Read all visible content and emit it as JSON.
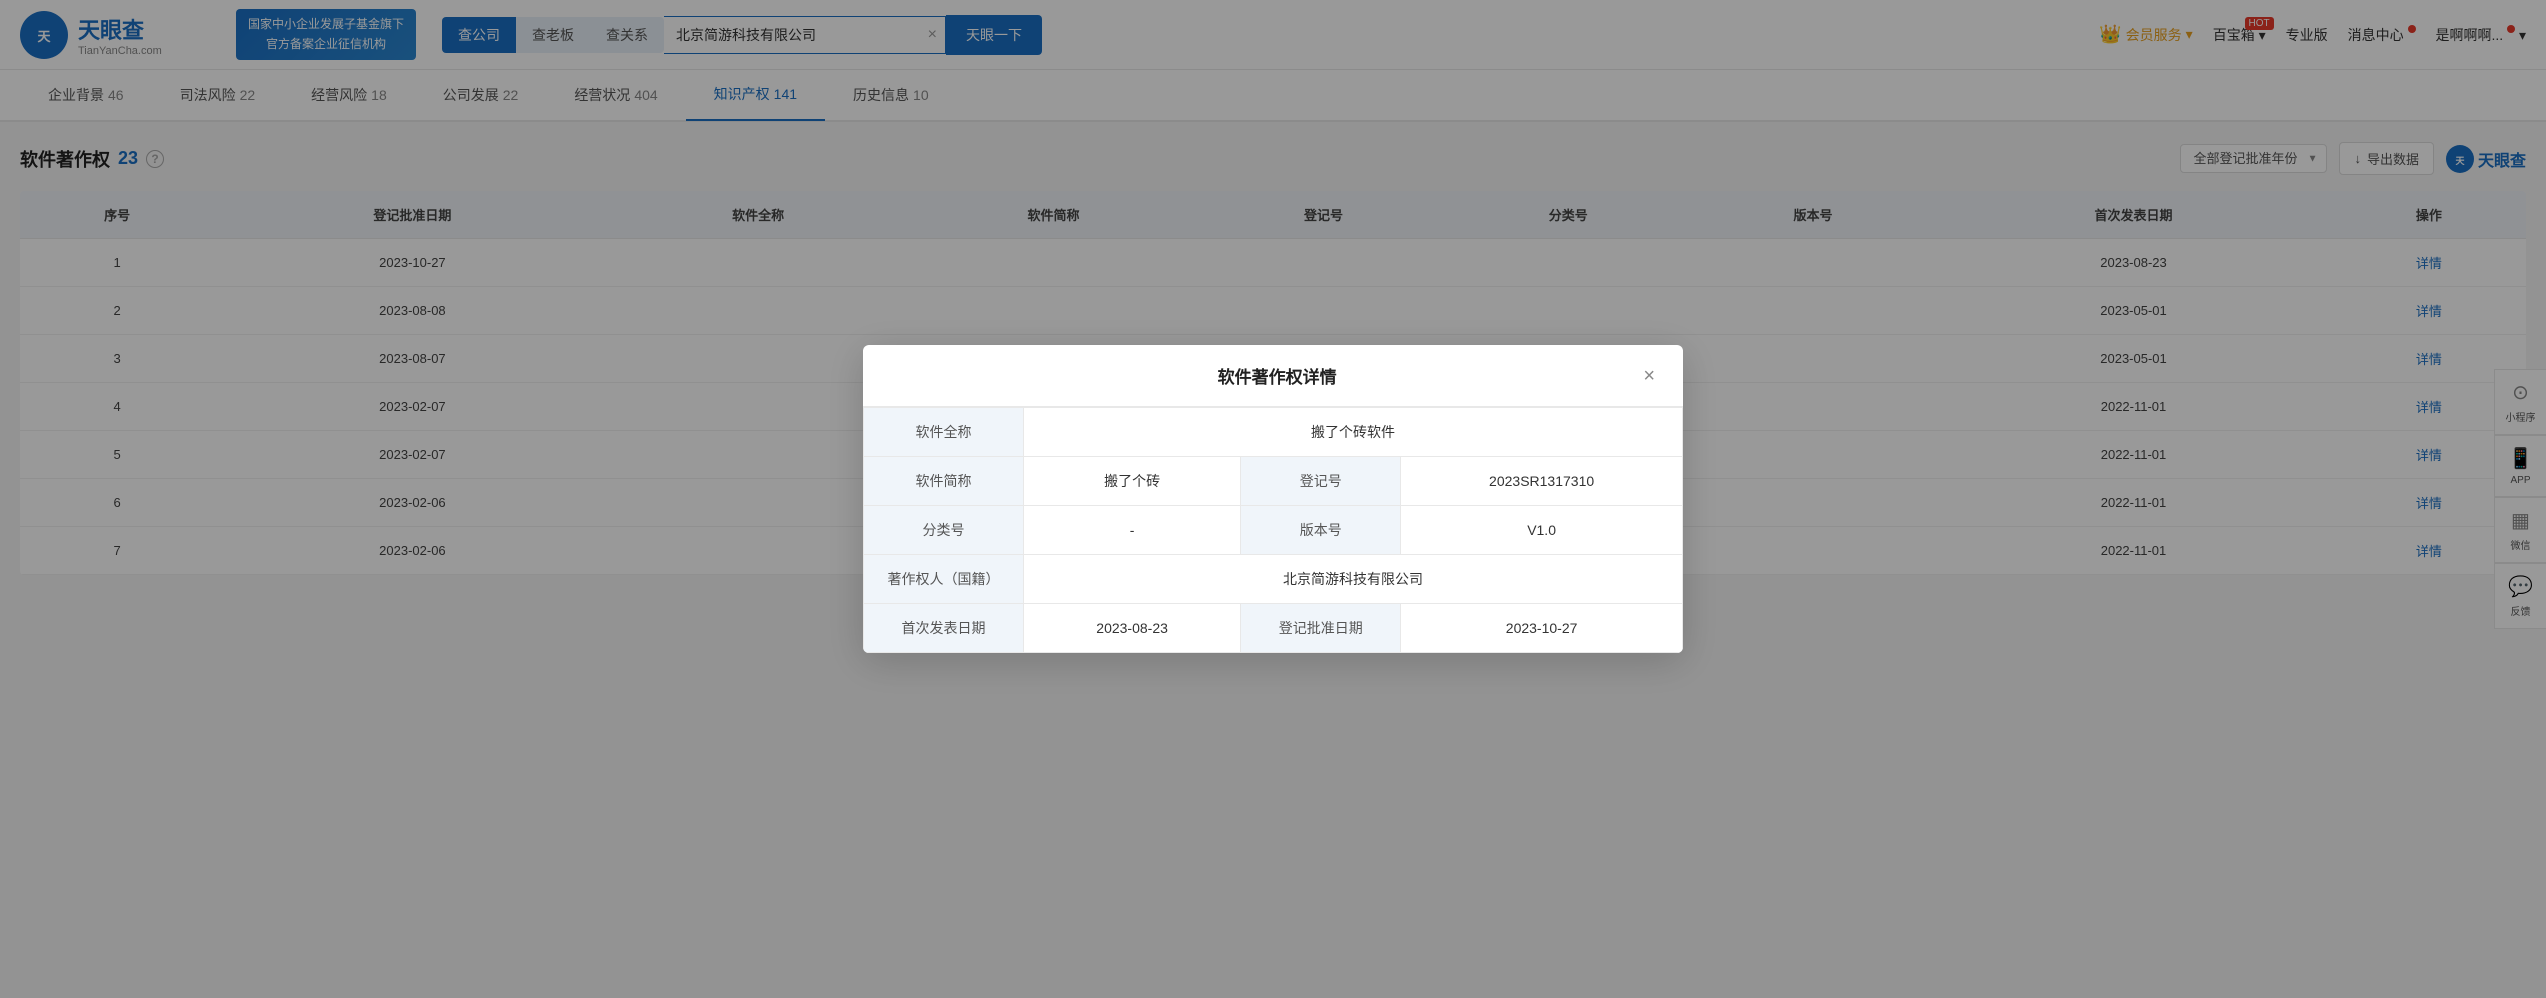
{
  "header": {
    "logo_cn": "天眼查",
    "logo_en": "TianYanCha.com",
    "banner_line1": "国家中小企业发展子基金旗下",
    "banner_line2": "官方备案企业征信机构",
    "search_tab_active": "查公司",
    "search_tab2": "查老板",
    "search_tab3": "查关系",
    "search_value": "北京简游科技有限公司",
    "search_btn": "天眼一下",
    "vip": "会员服务",
    "baobao": "百宝箱",
    "hot_label": "HOT",
    "pro": "专业版",
    "message": "消息中心",
    "user": "是啊啊啊..."
  },
  "sub_nav": {
    "items": [
      {
        "label": "企业背景",
        "count": "46",
        "active": false
      },
      {
        "label": "司法风险",
        "count": "22",
        "active": false
      },
      {
        "label": "经营风险",
        "count": "18",
        "active": false
      },
      {
        "label": "公司发展",
        "count": "22",
        "active": false
      },
      {
        "label": "经营状况",
        "count": "404",
        "active": false
      },
      {
        "label": "知识产权",
        "count": "141",
        "active": true
      },
      {
        "label": "历史信息",
        "count": "10",
        "active": false
      }
    ]
  },
  "section": {
    "title": "软件著作权",
    "count": "23",
    "year_placeholder": "全部登记批准年份",
    "export_btn": "导出数据",
    "watermark": "天眼查"
  },
  "table": {
    "columns": [
      "序号",
      "登记批准日期",
      "软件全称",
      "软件简称",
      "登记号",
      "分类号",
      "版本号",
      "首次发表日期",
      "操作"
    ],
    "rows": [
      {
        "id": 1,
        "reg_date": "2023-10-27",
        "full_name": "",
        "short_name": "",
        "reg_no": "",
        "class_no": "",
        "version": "",
        "pub_date": "2023-08-23",
        "action": "详情"
      },
      {
        "id": 2,
        "reg_date": "2023-08-08",
        "full_name": "",
        "short_name": "",
        "reg_no": "",
        "class_no": "",
        "version": "",
        "pub_date": "2023-05-01",
        "action": "详情"
      },
      {
        "id": 3,
        "reg_date": "2023-08-07",
        "full_name": "",
        "short_name": "",
        "reg_no": "",
        "class_no": "",
        "version": "",
        "pub_date": "2023-05-01",
        "action": "详情"
      },
      {
        "id": 4,
        "reg_date": "2023-02-07",
        "full_name": "",
        "short_name": "",
        "reg_no": "",
        "class_no": "",
        "version": "",
        "pub_date": "2022-11-01",
        "action": "详情"
      },
      {
        "id": 5,
        "reg_date": "2023-02-07",
        "full_name": "",
        "short_name": "",
        "reg_no": "",
        "class_no": "",
        "version": "",
        "pub_date": "2022-11-01",
        "action": "详情"
      },
      {
        "id": 6,
        "reg_date": "2023-02-06",
        "full_name": "",
        "short_name": "",
        "reg_no": "",
        "class_no": "",
        "version": "",
        "pub_date": "2022-11-01",
        "action": "详情"
      },
      {
        "id": 7,
        "reg_date": "2023-02-06",
        "full_name": "",
        "short_name": "",
        "reg_no": "",
        "class_no": "",
        "version": "",
        "pub_date": "2022-11-01",
        "action": "详情"
      }
    ]
  },
  "modal": {
    "title": "软件著作权详情",
    "close_label": "×",
    "fields": [
      {
        "label": "软件全称",
        "value": "搬了个砖软件",
        "colspan": true
      },
      {
        "label": "软件简称",
        "value": "搬了个砖",
        "label2": "登记号",
        "value2": "2023SR1317310"
      },
      {
        "label": "分类号",
        "value": "-",
        "label2": "版本号",
        "value2": "V1.0"
      },
      {
        "label": "著作权人（国籍）",
        "value": "北京简游科技有限公司",
        "colspan": true
      },
      {
        "label": "首次发表日期",
        "value": "2023-08-23",
        "label2": "登记批准日期",
        "value2": "2023-10-27"
      }
    ]
  },
  "side_icons": [
    {
      "symbol": "☎",
      "label": "小程序"
    },
    {
      "symbol": "📱",
      "label": "APP"
    },
    {
      "symbol": "≡",
      "label": "微信"
    },
    {
      "symbol": "💬",
      "label": "反馈"
    }
  ]
}
